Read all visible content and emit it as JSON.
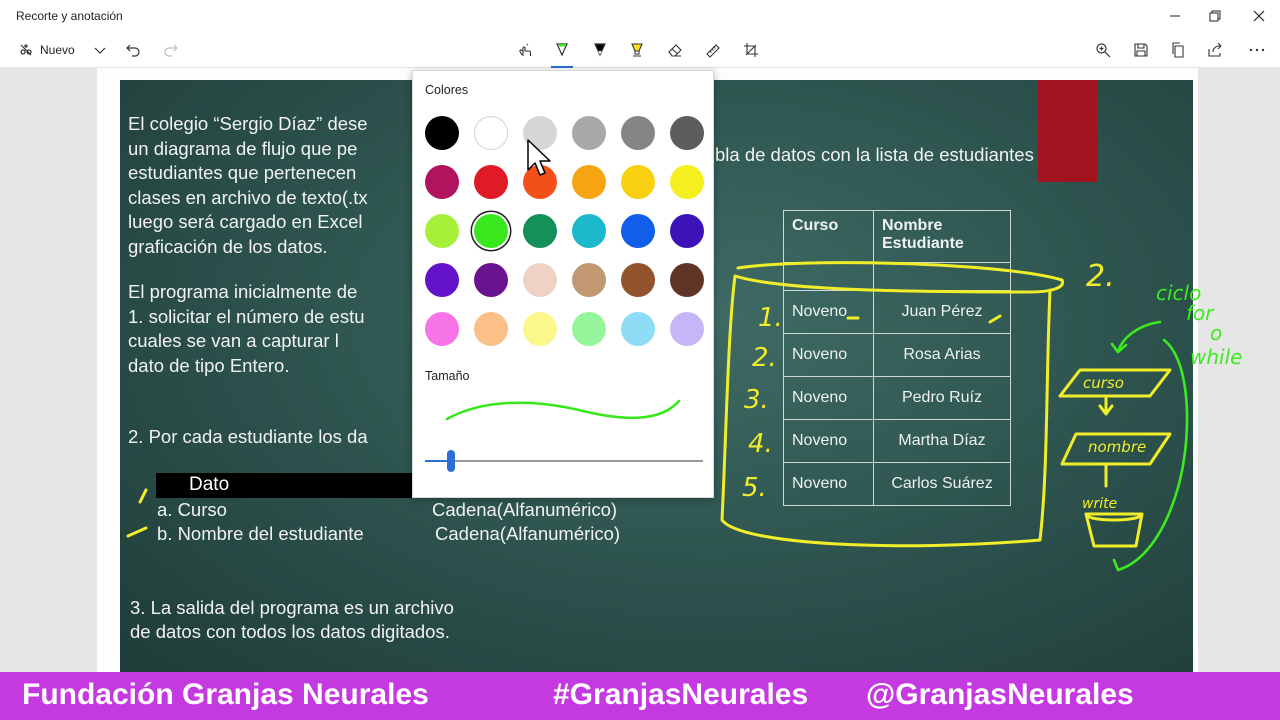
{
  "window": {
    "title": "Recorte y anotación",
    "minimize_icon": "minimize-icon",
    "maximize_icon": "restore-icon",
    "close_icon": "close-icon"
  },
  "toolbar": {
    "new_label": "Nuevo",
    "left_tools": [
      "new-snip-icon",
      "chevron-down-icon",
      "undo-icon",
      "redo-icon"
    ],
    "center_tools": [
      "touch-writing-icon",
      "ballpoint-pen-icon",
      "pencil-icon",
      "highlighter-icon",
      "eraser-icon",
      "ruler-icon",
      "crop-icon"
    ],
    "active_tool": "ballpoint-pen-icon",
    "right_tools": [
      "zoom-icon",
      "save-icon",
      "copy-icon",
      "share-icon",
      "more-icon"
    ],
    "accent": "#2b6fd6"
  },
  "slide": {
    "left_lines": [
      "El colegio “Sergio Díaz” dese",
      "un diagrama de flujo que pe",
      "estudiantes que pertenecen",
      "clases en archivo de texto(.tx",
      "luego será cargado en Excel",
      "graficación de los datos."
    ],
    "right_line": "bla de datos con la lista de estudiantes",
    "program_lines": [
      "El programa inicialmente  de",
      "1.   solicitar el número de estu",
      "       cuales se van a capturar l",
      "       dato de tipo Entero."
    ],
    "point2": "2. Por cada estudiante los da",
    "dato_header": "Dato",
    "item_a": "a.  Curso",
    "item_a_type": "Cadena(Alfanumérico)",
    "item_b": "b.  Nombre del estudiante",
    "item_b_type": "Cadena(Alfanumérico)",
    "point3_line1": "3. La salida del programa es un archivo",
    "point3_line2": "de datos con todos los datos digitados.",
    "table": {
      "headers": [
        "Curso",
        "Nombre Estudiante"
      ],
      "rows": [
        [
          "Noveno",
          "Juan Pérez"
        ],
        [
          "Noveno",
          "Rosa Arias"
        ],
        [
          "Noveno",
          "Pedro Ruíz"
        ],
        [
          "Noveno",
          "Martha Díaz"
        ],
        [
          "Noveno",
          "Carlos Suárez"
        ]
      ]
    },
    "accent_red": "#a3121f"
  },
  "annotations": {
    "numbers": [
      "1.",
      "2.",
      "3.",
      "4.",
      "5."
    ],
    "question": "2.",
    "loop_note": [
      "ciclo",
      "for",
      "o",
      "while"
    ],
    "flow_curso": "curso",
    "flow_nombre": "nombre",
    "flow_write": "write",
    "yellow": "#f0ee2a",
    "green": "#3dea1f"
  },
  "color_popup": {
    "colors_label": "Colores",
    "size_label": "Tamaño",
    "swatches": [
      [
        "#000000",
        "#ffffff",
        "#d6d6d6",
        "#a9a9a9",
        "#858585",
        "#5d5d5d"
      ],
      [
        "#b1135e",
        "#e01a26",
        "#f25018",
        "#f7a413",
        "#f9d00f",
        "#f5ef20"
      ],
      [
        "#a6f03a",
        "#38e81d",
        "#169059",
        "#1cb9cc",
        "#125ee8",
        "#3c13b8"
      ],
      [
        "#6212c8",
        "#6a138f",
        "#efd2c4",
        "#c29872",
        "#92532c",
        "#5e3526"
      ],
      [
        "#f774e8",
        "#fbc088",
        "#fbf78a",
        "#96f59a",
        "#8fdcf7",
        "#c5b7f7"
      ]
    ],
    "selected": "#38e81d",
    "size_value": 0.1
  },
  "footer": {
    "left": "Fundación Granjas Neurales",
    "middle": "#GranjasNeurales",
    "right": "@GranjasNeurales",
    "background": "#c53ae0"
  }
}
